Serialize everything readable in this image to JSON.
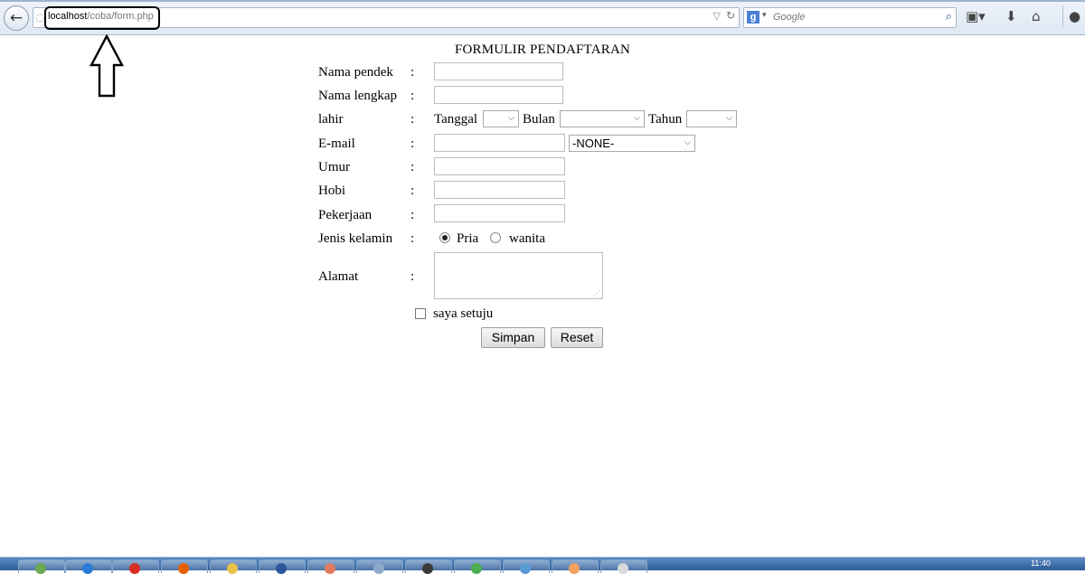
{
  "browser": {
    "url_host": "localhost",
    "url_path": "/coba/form.php",
    "search_placeholder": "Google",
    "search_engine_letter": "g"
  },
  "form": {
    "title": "FORMULIR PENDAFTARAN",
    "colon": ":",
    "fields": {
      "nama_pendek": "Nama pendek",
      "nama_lengkap": "Nama lengkap",
      "lahir": "lahir",
      "email": "E-mail",
      "umur": "Umur",
      "hobi": "Hobi",
      "pekerjaan": "Pekerjaan",
      "jenis_kelamin": "Jenis kelamin",
      "alamat": "Alamat"
    },
    "lahir_labels": {
      "tanggal": "Tanggal",
      "bulan": "Bulan",
      "tahun": "Tahun"
    },
    "email_domain_selected": "-NONE-",
    "gender_options": [
      {
        "label": "Pria",
        "checked": true
      },
      {
        "label": "wanita",
        "checked": false
      }
    ],
    "agree_label": "saya setuju",
    "agree_checked": false,
    "buttons": {
      "submit": "Simpan",
      "reset": "Reset"
    }
  },
  "taskbar": {
    "clock": "11:40"
  }
}
